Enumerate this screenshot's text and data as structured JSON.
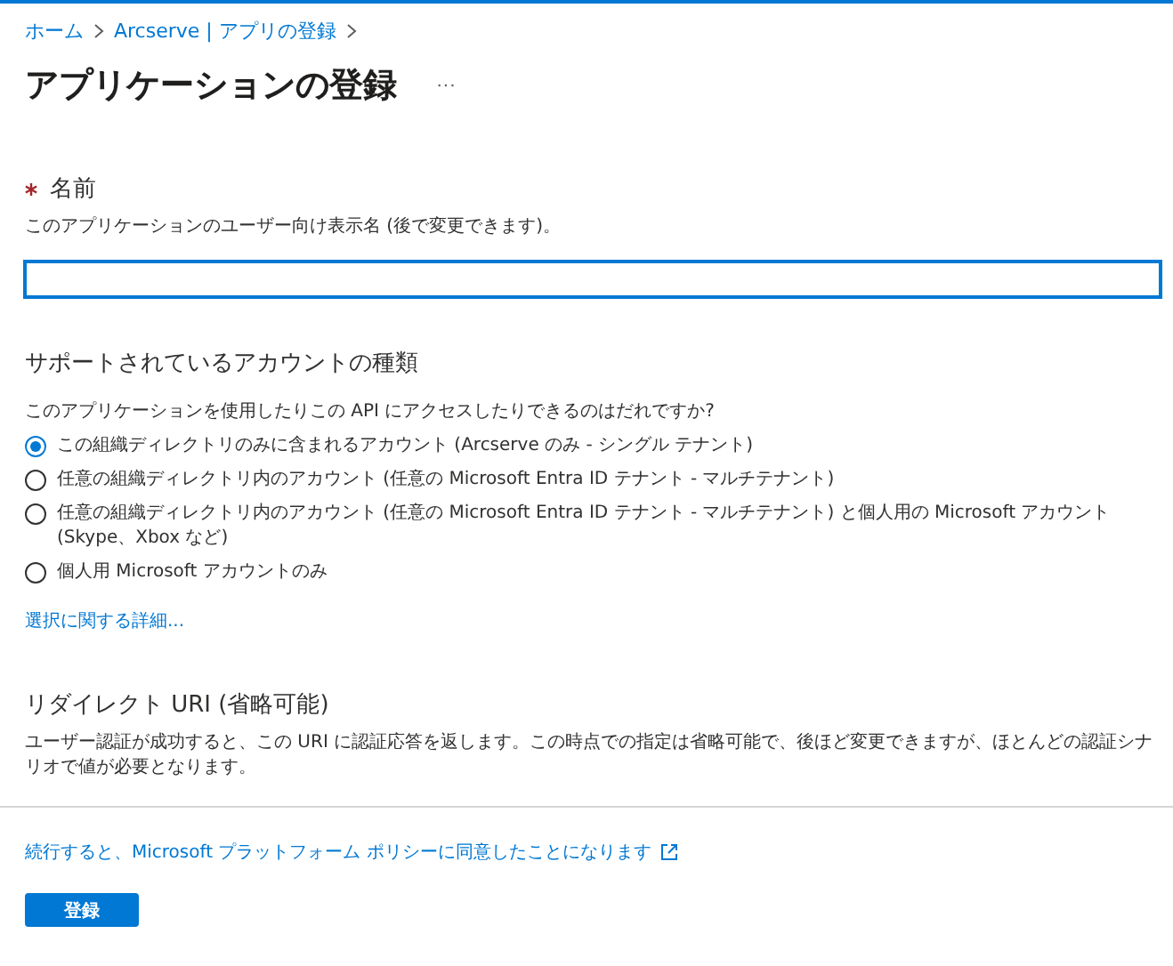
{
  "breadcrumb": [
    "ホーム",
    "Arcserve | アプリの登録"
  ],
  "title": "アプリケーションの登録",
  "title_menu": "···",
  "name_section": {
    "label": "名前",
    "required": true,
    "description": "このアプリケーションのユーザー向け表示名 (後で変更できます)。"
  },
  "account_types": {
    "heading": "サポートされているアカウントの種類",
    "question": "このアプリケーションを使用したりこの API にアクセスしたりできるのはだれですか?",
    "options": [
      {
        "label": "この組織ディレクトリのみに含まれるアカウント (Arcserve のみ - シングル テナント)",
        "selected": true
      },
      {
        "label": "任意の組織ディレクトリ内のアカウント (任意の Microsoft Entra ID テナント - マルチテナント)",
        "selected": false
      },
      {
        "label": "任意の組織ディレクトリ内のアカウント (任意の Microsoft Entra ID テナント - マルチテナント) と個人用の Microsoft アカウント (Skype、Xbox など)",
        "selected": false
      },
      {
        "label": "個人用 Microsoft アカウントのみ",
        "selected": false
      }
    ],
    "help_link": "選択に関する詳細..."
  },
  "redirect": {
    "heading": "リダイレクト URI (省略可能)",
    "description": "ユーザー認証が成功すると、この URI に認証応答を返します。この時点での指定は省略可能で、後ほど変更できますが、ほとんどの認証シナリオで値が必要となります。"
  },
  "policy_link": "続行すると、Microsoft プラットフォーム ポリシーに同意したことになります",
  "register_button": "登録"
}
